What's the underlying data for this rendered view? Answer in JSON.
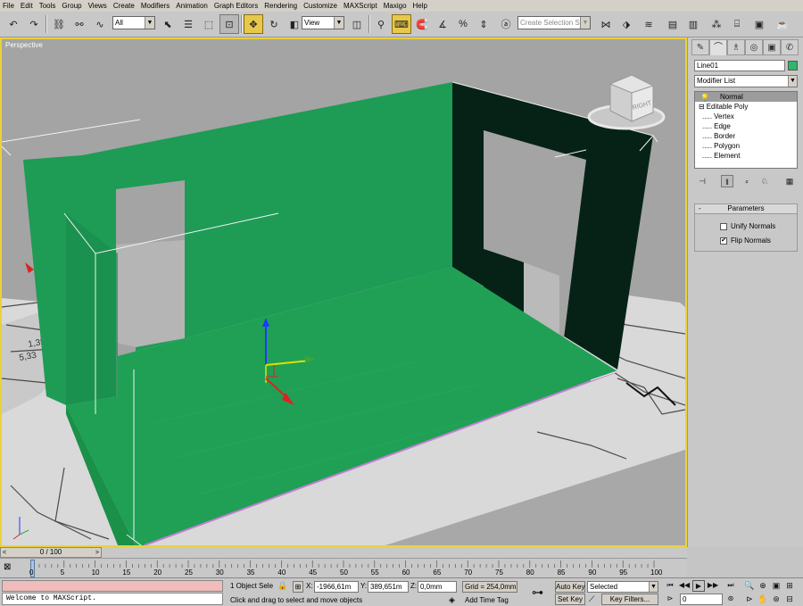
{
  "menu": [
    "File",
    "Edit",
    "Tools",
    "Group",
    "Views",
    "Create",
    "Modifiers",
    "Animation",
    "Graph Editors",
    "Rendering",
    "Customize",
    "MAXScript",
    "Maxigo",
    "Help"
  ],
  "toolbar": {
    "selection_filter": "All",
    "ref_coord": "View",
    "named_selection_placeholder": "Create Selection Set"
  },
  "viewport": {
    "label": "Perspective",
    "viewcube_label": "RIGHT",
    "object_color": "#1e9b55",
    "dark_wall_color": "#062216"
  },
  "command_panel": {
    "object_name": "Line01",
    "object_color": "#2eb86a",
    "modifier_list": "Modifier List",
    "stack": [
      {
        "label": "Normal",
        "indent": 0,
        "selected": true,
        "prefix": ""
      },
      {
        "label": "Editable Poly",
        "indent": 0,
        "selected": false,
        "prefix": "⊟"
      },
      {
        "label": "Vertex",
        "indent": 1,
        "selected": false,
        "prefix": "....."
      },
      {
        "label": "Edge",
        "indent": 1,
        "selected": false,
        "prefix": "....."
      },
      {
        "label": "Border",
        "indent": 1,
        "selected": false,
        "prefix": "....."
      },
      {
        "label": "Polygon",
        "indent": 1,
        "selected": false,
        "prefix": "....."
      },
      {
        "label": "Element",
        "indent": 1,
        "selected": false,
        "prefix": "....."
      }
    ],
    "rollout_title": "Parameters",
    "rollout_minus": "-",
    "unify_normals": {
      "label": "Unify Normals",
      "checked": false
    },
    "flip_normals": {
      "label": "Flip Normals",
      "checked": true
    }
  },
  "timeline": {
    "slider": "0 / 100",
    "ticks": [
      "0",
      "5",
      "10",
      "15",
      "20",
      "25",
      "30",
      "35",
      "40",
      "45",
      "50",
      "55",
      "60",
      "65",
      "70",
      "75",
      "80",
      "85",
      "90",
      "95",
      "100"
    ]
  },
  "status": {
    "maxscript_output": "Welcome to MAXScript.",
    "selection_count": "1 Object Sele",
    "x_label": "X:",
    "x_value": "-1966,61m",
    "y_label": "Y:",
    "y_value": "389,651m",
    "z_label": "Z:",
    "z_value": "0,0mm",
    "grid": "Grid = 254,0mm",
    "prompt": "Click and drag to select and move objects",
    "add_time_tag": "Add Time Tag",
    "auto_key": "Auto Key",
    "set_key": "Set Key",
    "key_mode": "Selected",
    "key_filters": "Key Filters...",
    "current_frame": "0"
  }
}
